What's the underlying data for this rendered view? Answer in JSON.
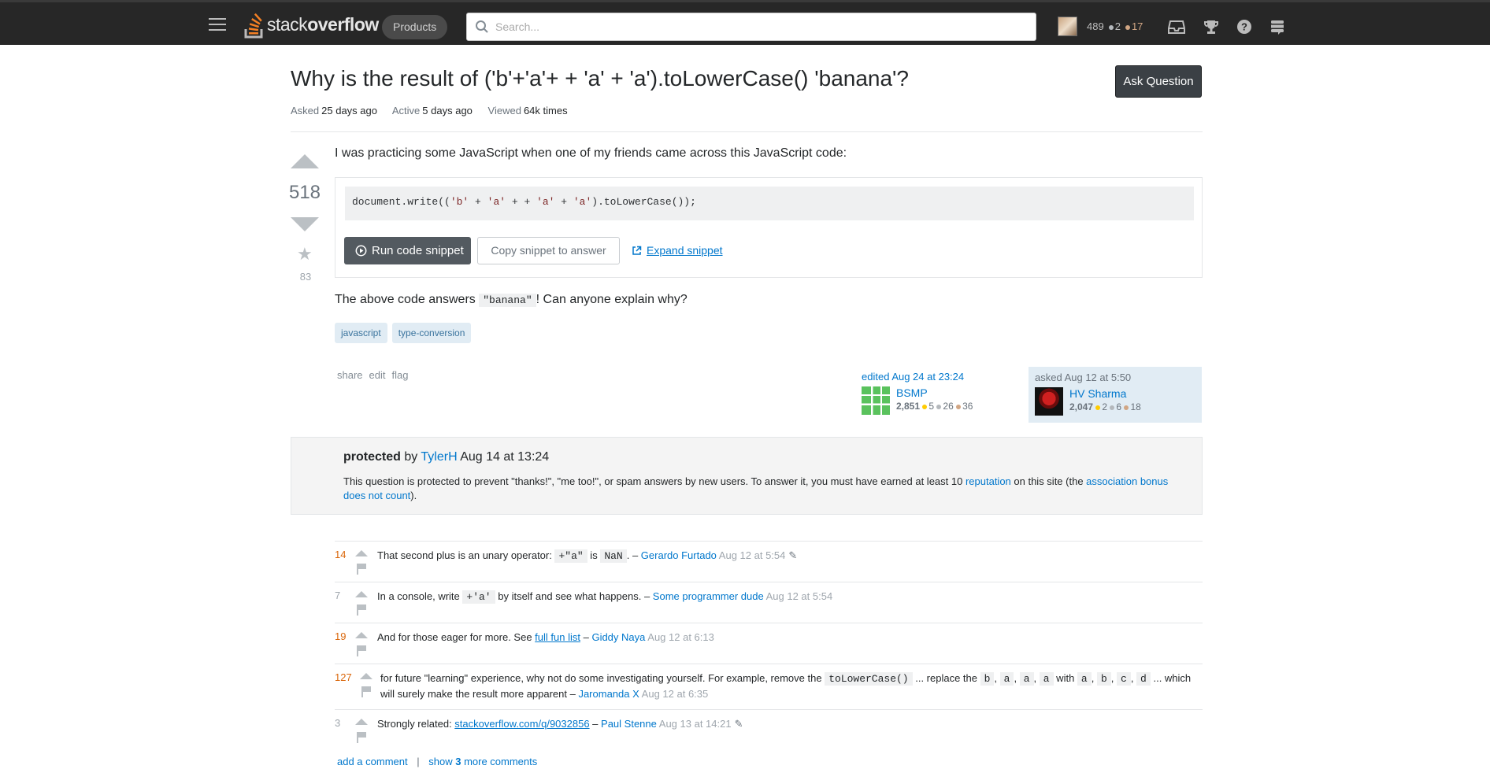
{
  "topbar": {
    "logo_text_light": "stack",
    "logo_text_bold": "overflow",
    "products_label": "Products",
    "search_placeholder": "Search...",
    "reputation": "489",
    "silver_badges": "2",
    "bronze_badges": "17",
    "icons": [
      "hamburger-icon",
      "inbox-icon",
      "trophy-icon",
      "help-icon",
      "stack-exchange-icon"
    ]
  },
  "question": {
    "title": "Why is the result of ('b'+'a'+ + 'a' + 'a').toLowerCase() 'banana'?",
    "ask_button": "Ask Question",
    "asked_label": "Asked",
    "asked_value": "25 days ago",
    "active_label": "Active",
    "active_value": "5 days ago",
    "viewed_label": "Viewed",
    "viewed_value": "64k times",
    "score": "518",
    "favorites": "83",
    "body_intro": "I was practicing some JavaScript when one of my friends came across this JavaScript code:",
    "code": {
      "pre": "document.write((",
      "s1": "'b'",
      "plus1": " + ",
      "s2": "'a'",
      "plus2": " + + ",
      "s3": "'a'",
      "plus3": " + ",
      "s4": "'a'",
      "post": ").toLowerCase());"
    },
    "run_button": "Run code snippet",
    "copy_button": "Copy snippet to answer",
    "expand_link": "Expand snippet",
    "body_outro_pre": "The above code answers ",
    "body_outro_code": "\"banana\"",
    "body_outro_post": "! Can anyone explain why?",
    "tags": [
      "javascript",
      "type-conversion"
    ],
    "menu": {
      "share": "share",
      "edit": "edit",
      "flag": "flag"
    },
    "editor": {
      "label": "edited Aug 24 at 23:24",
      "name": "BSMP",
      "rep": "2,851",
      "gold": "5",
      "silver": "26",
      "bronze": "36"
    },
    "owner": {
      "label": "asked Aug 12 at 5:50",
      "name": "HV Sharma",
      "rep": "2,047",
      "gold": "2",
      "silver": "6",
      "bronze": "18"
    }
  },
  "protected": {
    "title_bold": "protected",
    "by": " by ",
    "user": "TylerH",
    "date": " Aug 14 at 13:24",
    "desc_pre": "This question is protected to prevent \"thanks!\", \"me too!\", or spam answers by new users. To answer it, you must have earned at least 10 ",
    "rep_link": "reputation",
    "desc_mid": " on this site (the ",
    "bonus_link": "association bonus does not count",
    "desc_post": ")."
  },
  "comments": [
    {
      "score": "14",
      "t1": "That second plus is an unary operator: ",
      "c1": "+\"a\"",
      "t2": " is ",
      "c2": "NaN",
      "t3": ". – ",
      "user": "Gerardo Furtado",
      "date": " Aug 12 at 5:54"
    },
    {
      "score": "7",
      "t1": "In a console, write ",
      "c1": "+'a'",
      "t2": " by itself and see what happens. – ",
      "user": "Some programmer dude",
      "date": " Aug 12 at 5:54"
    },
    {
      "score": "19",
      "t1": "And for those eager for more. See ",
      "link": "full fun list",
      "t2": " – ",
      "user": "Giddy Naya",
      "date": " Aug 12 at 6:13"
    },
    {
      "score": "127",
      "t1": "for future \"learning\" experience, why not do some investigating yourself. For example, remove the ",
      "c1": "toLowerCase()",
      "t2": " ... replace the ",
      "ca": "b",
      "cb": "a",
      "cc": "a",
      "cd": "a",
      "t3": " with ",
      "ce": "a",
      "cf": "b",
      "cg": "c",
      "ch": "d",
      "t4": " ... which will surely make the result more apparent – ",
      "user": "Jaromanda X",
      "date": " Aug 12 at 6:35"
    },
    {
      "score": "3",
      "t1": "Strongly related: ",
      "link": "stackoverflow.com/q/9032856",
      "t2": " – ",
      "user": "Paul Stenne",
      "date": " Aug 13 at 14:21"
    }
  ],
  "comment_footer": {
    "add": "add a comment",
    "sep": "|",
    "show_pre": "show ",
    "show_count": "3",
    "show_post": " more comments"
  },
  "colors": {
    "topbar": "#272727",
    "link": "#0077cc",
    "comment_score_hot": "#da670b",
    "tag_bg": "#e1ecf4"
  }
}
